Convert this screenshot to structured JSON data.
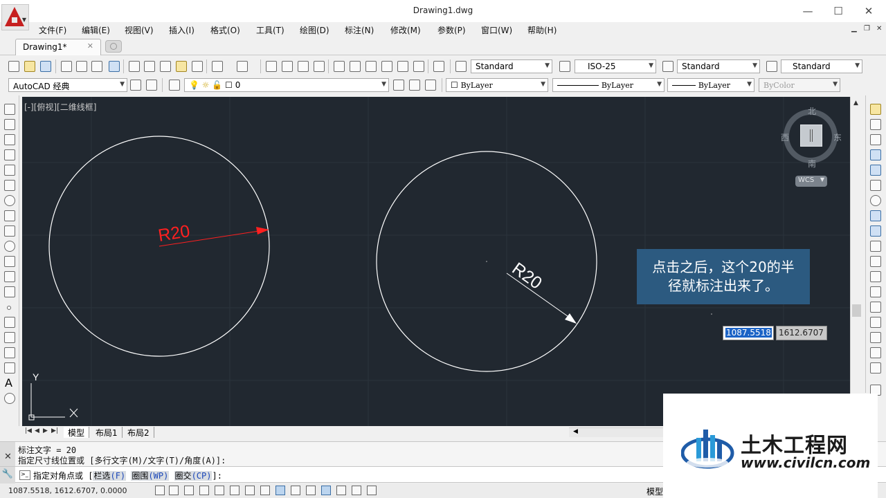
{
  "window": {
    "title": "Drawing1.dwg",
    "minimize": "—",
    "maximize": "☐",
    "close": "✕"
  },
  "menu": [
    "文件(F)",
    "编辑(E)",
    "视图(V)",
    "插入(I)",
    "格式(O)",
    "工具(T)",
    "绘图(D)",
    "标注(N)",
    "修改(M)",
    "参数(P)",
    "窗口(W)",
    "帮助(H)"
  ],
  "doc_tab": {
    "label": "Drawing1*",
    "close": "✕"
  },
  "styles": {
    "text_style": "Standard",
    "dim_style": "ISO-25",
    "table_style": "Standard",
    "multileader_style": "Standard"
  },
  "workspace": "AutoCAD 经典",
  "layer": "0",
  "properties": {
    "color": "ByLayer",
    "linetype": "ByLayer",
    "lineweight": "ByLayer",
    "plot_style": "ByColor"
  },
  "viewport_label": "[-][俯视][二维线框]",
  "viewcube": {
    "north": "北",
    "south": "南",
    "east": "东",
    "west": "西",
    "wcs": "WCS"
  },
  "drawing": {
    "dimension_left": "R20",
    "dimension_right": "R20"
  },
  "callout": {
    "line1": "点击之后，这个20的半",
    "line2": "径就标注出来了。"
  },
  "coordinate_inputs": {
    "x": "1087.5518",
    "y": "1612.6707"
  },
  "ucs": {
    "y": "Y",
    "x": "X"
  },
  "layout_tabs": [
    "模型",
    "布局1",
    "布局2"
  ],
  "command": {
    "history1": "标注文字 = 20",
    "history2": "指定尺寸线位置或 [多行文字(M)/文字(T)/角度(A)]:",
    "prompt_prefix": "指定对角点或 [",
    "opt1_label": "栏选",
    "opt1_key": "(F)",
    "opt2_label": "圈围",
    "opt2_key": "(WP)",
    "opt3_label": "圈交",
    "opt3_key": "(CP)",
    "prompt_suffix": "]:"
  },
  "status": {
    "coords": "1087.5518,  1612.6707, 0.0000",
    "model": "模型"
  },
  "watermark": {
    "title": "土木工程网",
    "url": "www.civilcn.com"
  },
  "colors": {
    "canvas": "#212830",
    "dimension_red": "#ff2020",
    "callout_bg": "#2c5a80",
    "geometry": "#ffffff"
  }
}
